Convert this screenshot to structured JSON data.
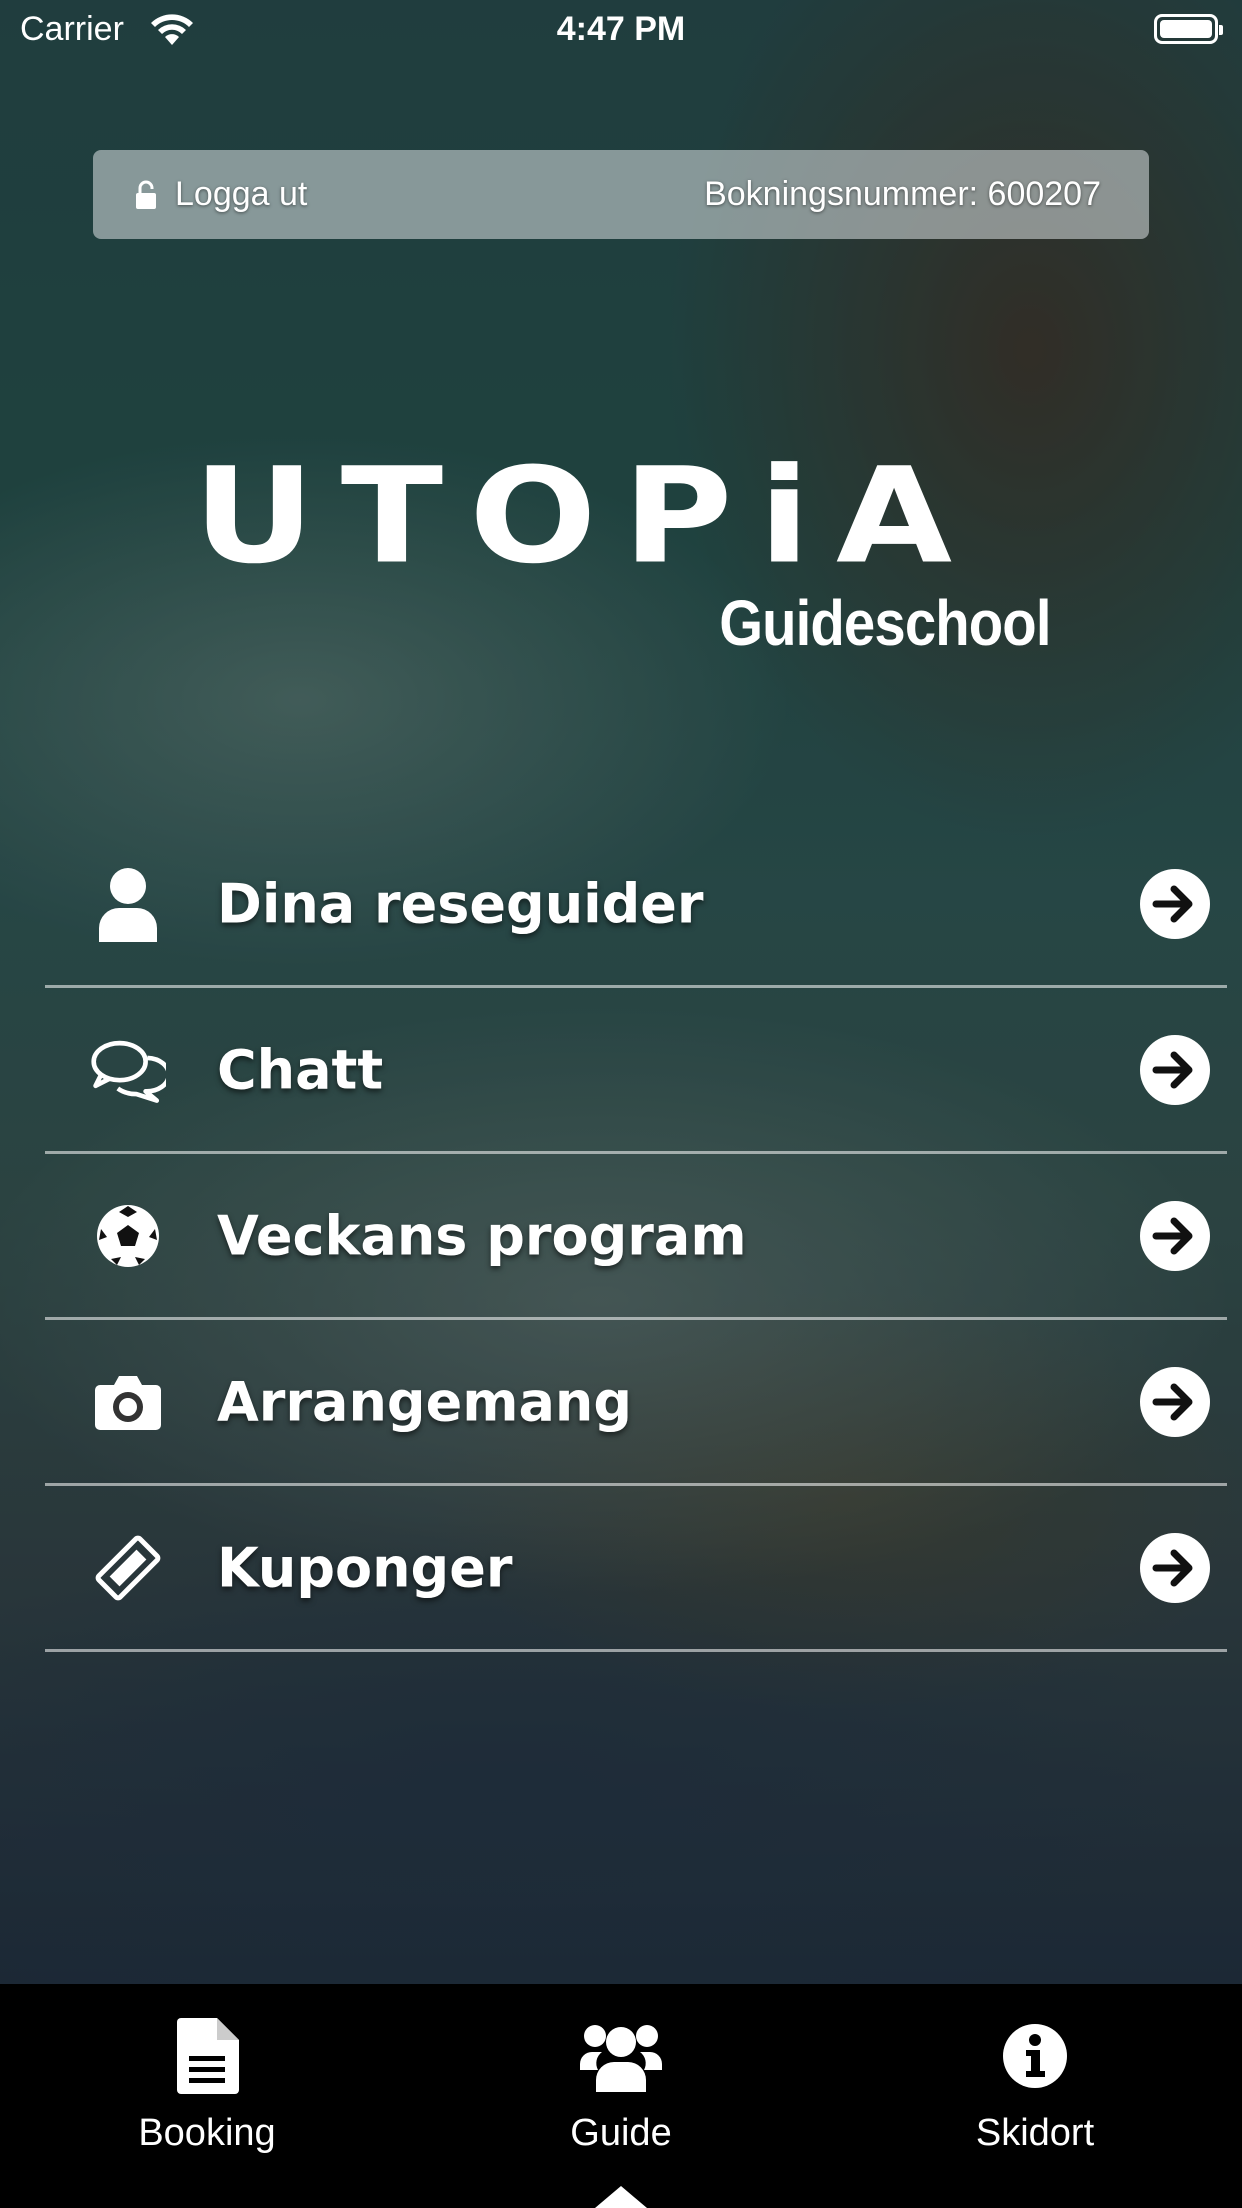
{
  "status_bar": {
    "carrier": "Carrier",
    "time": "4:47 PM"
  },
  "account_bar": {
    "logout_label": "Logga ut",
    "booking_number": "Bokningsnummer: 600207"
  },
  "logo": {
    "word": "UTOPiA",
    "subtitle": "Guideschool"
  },
  "menu": {
    "items": [
      {
        "label": "Dina reseguider",
        "icon": "person-icon"
      },
      {
        "label": "Chatt",
        "icon": "chat-bubbles-icon"
      },
      {
        "label": "Veckans program",
        "icon": "soccer-ball-icon"
      },
      {
        "label": "Arrangemang",
        "icon": "camera-icon"
      },
      {
        "label": "Kuponger",
        "icon": "ticket-icon"
      }
    ]
  },
  "tabbar": {
    "tabs": [
      {
        "label": "Booking",
        "icon": "document-icon",
        "active": false
      },
      {
        "label": "Guide",
        "icon": "users-icon",
        "active": true
      },
      {
        "label": "Skidort",
        "icon": "info-icon",
        "active": false
      }
    ]
  },
  "colors": {
    "tabbar_bg": "#000000",
    "text": "#ffffff",
    "account_bar_bg": "rgba(220,226,228,0.55)"
  }
}
